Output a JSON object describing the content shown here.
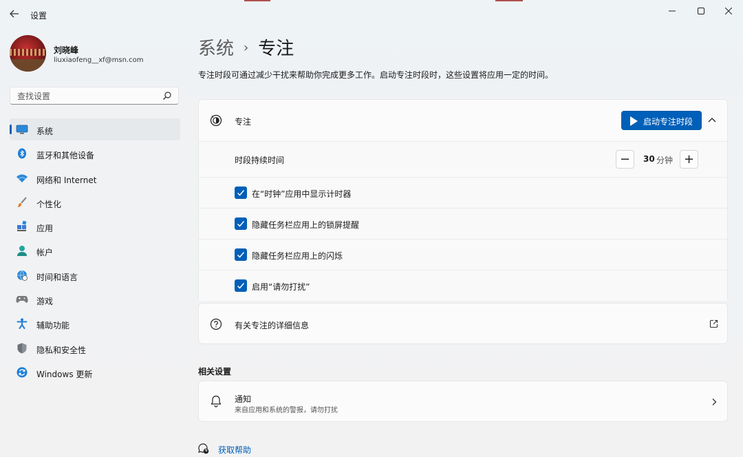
{
  "window": {
    "title": "设置",
    "accent_color": "#005fb8"
  },
  "profile": {
    "name": "刘晓峰",
    "email": "liuxiaofeng__xf@msn.com"
  },
  "search": {
    "placeholder": "查找设置"
  },
  "sidebar": {
    "items": [
      {
        "label": "系统",
        "icon": "monitor-icon",
        "active": true
      },
      {
        "label": "蓝牙和其他设备",
        "icon": "bluetooth-icon"
      },
      {
        "label": "网络和 Internet",
        "icon": "wifi-icon"
      },
      {
        "label": "个性化",
        "icon": "brush-icon"
      },
      {
        "label": "应用",
        "icon": "apps-icon"
      },
      {
        "label": "帐户",
        "icon": "person-icon"
      },
      {
        "label": "时间和语言",
        "icon": "globe-clock-icon"
      },
      {
        "label": "游戏",
        "icon": "gamepad-icon"
      },
      {
        "label": "辅助功能",
        "icon": "accessibility-icon"
      },
      {
        "label": "隐私和安全性",
        "icon": "shield-icon"
      },
      {
        "label": "Windows 更新",
        "icon": "windows-update-icon"
      }
    ]
  },
  "main": {
    "breadcrumb_parent": "系统",
    "breadcrumb_separator": "›",
    "breadcrumb_current": "专注",
    "description": "专注时段可通过减少干扰来帮助你完成更多工作。启动专注时段时，这些设置将应用一定的时间。",
    "focus": {
      "label": "专注",
      "start_button": "启动专注时段",
      "duration_label": "时段持续时间",
      "duration_value": "30",
      "duration_unit": "分钟",
      "minus": "−",
      "plus": "+",
      "options": [
        {
          "label": "在“时钟”应用中显示计时器",
          "checked": true
        },
        {
          "label": "隐藏任务栏应用上的锁屏提醒",
          "checked": true
        },
        {
          "label": "隐藏任务栏应用上的闪烁",
          "checked": true
        },
        {
          "label": "启用“请勿打扰”",
          "checked": true
        }
      ]
    },
    "info": {
      "label": "有关专注的详细信息"
    },
    "related_title": "相关设置",
    "notification": {
      "title": "通知",
      "subtitle": "来自应用和系统的警报，请勿打扰"
    },
    "help_label": "获取帮助"
  }
}
